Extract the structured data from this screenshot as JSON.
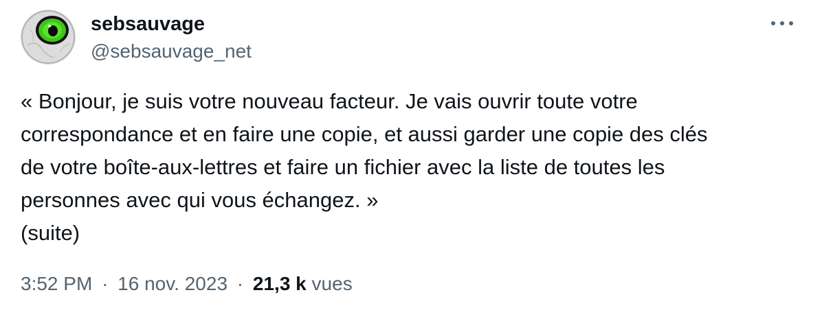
{
  "author": {
    "display_name": "sebsauvage",
    "handle": "@sebsauvage_net",
    "avatar_icon": "green-eye-avatar"
  },
  "more_icon": "more-options-icon",
  "tweet": {
    "lines": [
      "« Bonjour, je suis votre nouveau facteur. Je vais ouvrir toute votre",
      "correspondance et en faire une copie, et aussi garder une copie des clés",
      "de votre boîte-aux-lettres et faire un fichier avec la liste de toutes les",
      "personnes avec qui vous échangez. »",
      "(suite)"
    ]
  },
  "meta": {
    "time": "3:52 PM",
    "separator": "·",
    "date": "16 nov. 2023",
    "views_count": "21,3 k",
    "views_label": "vues"
  },
  "colors": {
    "text_primary": "#0f1419",
    "text_secondary": "#536471",
    "background": "#ffffff"
  }
}
